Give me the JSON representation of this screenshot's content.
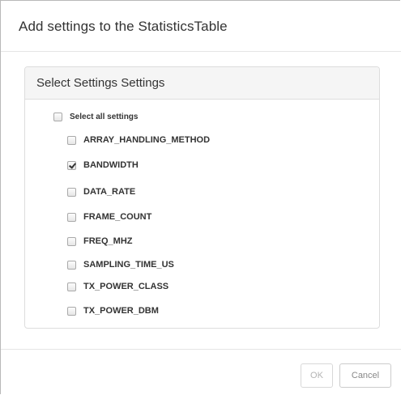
{
  "dialog": {
    "title": "Add settings to the StatisticsTable"
  },
  "panel": {
    "title": "Select Settings Settings",
    "select_all": {
      "label": "Select all settings",
      "checked": false
    },
    "settings": [
      {
        "label": "ARRAY_HANDLING_METHOD",
        "checked": false
      },
      {
        "label": "BANDWIDTH",
        "checked": true
      },
      {
        "label": "DATA_RATE",
        "checked": false
      },
      {
        "label": "FRAME_COUNT",
        "checked": false
      },
      {
        "label": "FREQ_MHZ",
        "checked": false
      },
      {
        "label": "SAMPLING_TIME_US",
        "checked": false
      },
      {
        "label": "TX_POWER_CLASS",
        "checked": false
      },
      {
        "label": "TX_POWER_DBM",
        "checked": false
      }
    ]
  },
  "footer": {
    "ok_label": "OK",
    "ok_disabled": true,
    "cancel_label": "Cancel"
  }
}
